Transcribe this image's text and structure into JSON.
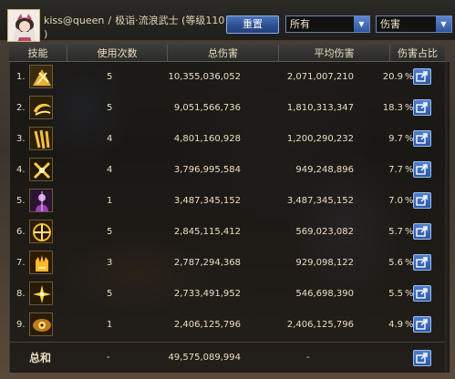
{
  "header": {
    "user": "kiss@queen",
    "separator": "/",
    "class_title": "极诣·流浪武士 (等级110",
    "class_title_cont": ")",
    "reset_label": "重置",
    "type_filter": "所有",
    "metric_filter": "伤害"
  },
  "table": {
    "columns": {
      "skill": "技能",
      "uses": "使用次数",
      "total": "总伤害",
      "avg": "平均伤害",
      "share": "伤害占比"
    },
    "rows": [
      {
        "rank": "1.",
        "icon": "swords-burst-icon",
        "uses": "5",
        "total": "10,355,036,052",
        "avg": "2,071,007,210",
        "share": "20.9",
        "unit": "%"
      },
      {
        "rank": "2.",
        "icon": "crescent-slash-icon",
        "uses": "5",
        "total": "9,051,566,736",
        "avg": "1,810,313,347",
        "share": "18.3",
        "unit": "%"
      },
      {
        "rank": "3.",
        "icon": "triple-slash-icon",
        "uses": "4",
        "total": "4,801,160,928",
        "avg": "1,200,290,232",
        "share": "9.7",
        "unit": "%"
      },
      {
        "rank": "4.",
        "icon": "cross-blade-icon",
        "uses": "4",
        "total": "3,796,995,584",
        "avg": "949,248,896",
        "share": "7.7",
        "unit": "%"
      },
      {
        "rank": "5.",
        "icon": "violet-warrior-icon",
        "uses": "1",
        "total": "3,487,345,152",
        "avg": "3,487,345,152",
        "share": "7.0",
        "unit": "%"
      },
      {
        "rank": "6.",
        "icon": "golden-seal-icon",
        "uses": "5",
        "total": "2,845,115,412",
        "avg": "569,023,082",
        "share": "5.7",
        "unit": "%"
      },
      {
        "rank": "7.",
        "icon": "flame-palm-icon",
        "uses": "3",
        "total": "2,787,294,368",
        "avg": "929,098,122",
        "share": "5.6",
        "unit": "%"
      },
      {
        "rank": "8.",
        "icon": "star-burst-icon",
        "uses": "5",
        "total": "2,733,491,952",
        "avg": "546,698,390",
        "share": "5.5",
        "unit": "%"
      },
      {
        "rank": "9.",
        "icon": "whirl-eye-icon",
        "uses": "1",
        "total": "2,406,125,796",
        "avg": "2,406,125,796",
        "share": "4.9",
        "unit": "%"
      }
    ],
    "total_row": {
      "label": "总和",
      "uses": "-",
      "total": "49,575,089,994",
      "avg": "-"
    }
  },
  "colors": {
    "accent_blue": "#2d4f93",
    "text": "#eadfc4",
    "icon_gold": "#e8b030"
  }
}
